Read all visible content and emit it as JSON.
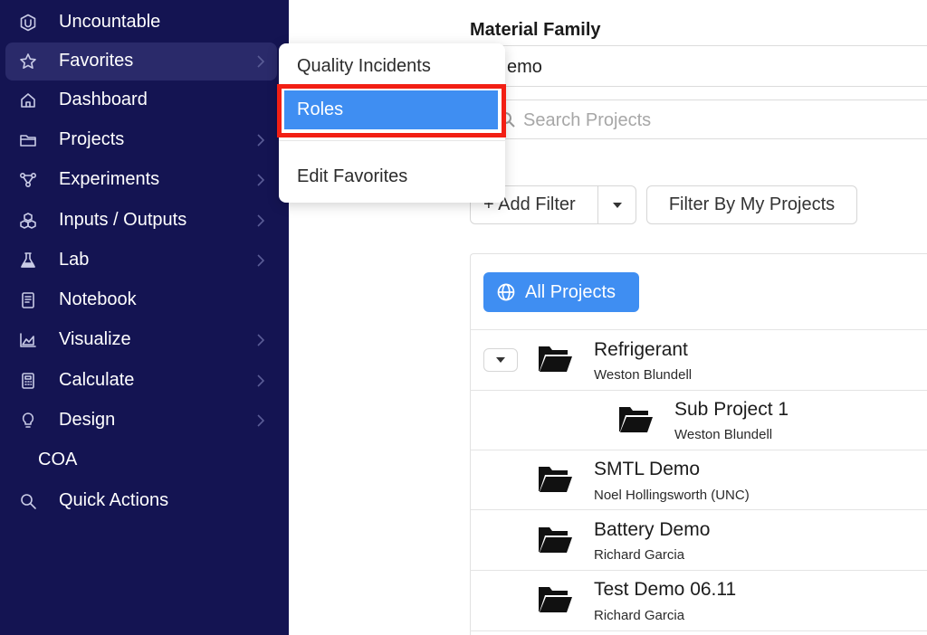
{
  "sidebar": {
    "items": [
      {
        "label": "Uncountable",
        "icon": "uncountable-logo-icon",
        "chevron": false
      },
      {
        "label": "Favorites",
        "icon": "star-icon",
        "chevron": true,
        "active": true
      },
      {
        "label": "Dashboard",
        "icon": "home-icon",
        "chevron": false
      },
      {
        "label": "Projects",
        "icon": "folder-icon",
        "chevron": true
      },
      {
        "label": "Experiments",
        "icon": "network-icon",
        "chevron": true
      },
      {
        "label": "Inputs / Outputs",
        "icon": "cubes-icon",
        "chevron": true
      },
      {
        "label": "Lab",
        "icon": "flask-icon",
        "chevron": true
      },
      {
        "label": "Notebook",
        "icon": "notebook-icon",
        "chevron": false
      },
      {
        "label": "Visualize",
        "icon": "area-chart-icon",
        "chevron": true
      },
      {
        "label": "Calculate",
        "icon": "calculator-icon",
        "chevron": true
      },
      {
        "label": "Design",
        "icon": "lightbulb-icon",
        "chevron": true
      },
      {
        "label": "COA",
        "icon": "",
        "chevron": false
      },
      {
        "label": "Quick Actions",
        "icon": "search-icon",
        "chevron": false
      }
    ]
  },
  "favorites_menu": {
    "items": [
      "Quality Incidents",
      "Roles",
      "Edit Favorites"
    ],
    "highlighted": "Roles"
  },
  "main": {
    "material_family_label": "Material Family",
    "material_family_value": "emo",
    "search_placeholder": "Search Projects",
    "add_filter_label": "+ Add Filter",
    "filter_my_projects_label": "Filter By My Projects",
    "all_projects_label": "All Projects",
    "projects": [
      {
        "name": "Refrigerant",
        "owner": "Weston Blundell",
        "expanded": true
      },
      {
        "name": "Sub Project 1",
        "owner": "Weston Blundell",
        "child": true
      },
      {
        "name": "SMTL Demo",
        "owner": "Noel Hollingsworth (UNC)"
      },
      {
        "name": "Battery Demo",
        "owner": "Richard Garcia"
      },
      {
        "name": "Test Demo 06.11",
        "owner": "Richard Garcia"
      }
    ]
  },
  "colors": {
    "sidebar_bg": "#141452",
    "accent_blue": "#3f8ef2",
    "highlight_red": "#f21f14"
  }
}
